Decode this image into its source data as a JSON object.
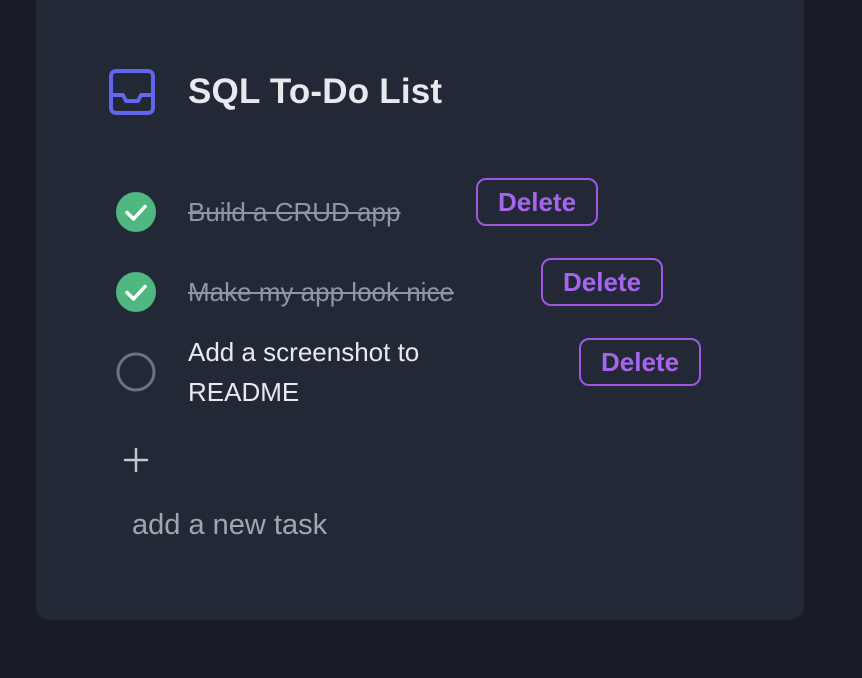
{
  "app": {
    "title": "SQL To-Do List",
    "icon": "inbox-icon"
  },
  "tasks": [
    {
      "label": "Build a CRUD app",
      "done": true,
      "delete_label": "Delete"
    },
    {
      "label": "Make my app look nice",
      "done": true,
      "delete_label": "Delete"
    },
    {
      "label": "Add a screenshot to README",
      "done": false,
      "delete_label": "Delete"
    }
  ],
  "new_task": {
    "icon": "plus-icon",
    "placeholder": "add a new task",
    "value": ""
  },
  "colors": {
    "background": "#171c28",
    "card": "#222836",
    "accent_icon": "#6366f1",
    "done_check": "#4fb780",
    "delete": "#a156e6"
  }
}
